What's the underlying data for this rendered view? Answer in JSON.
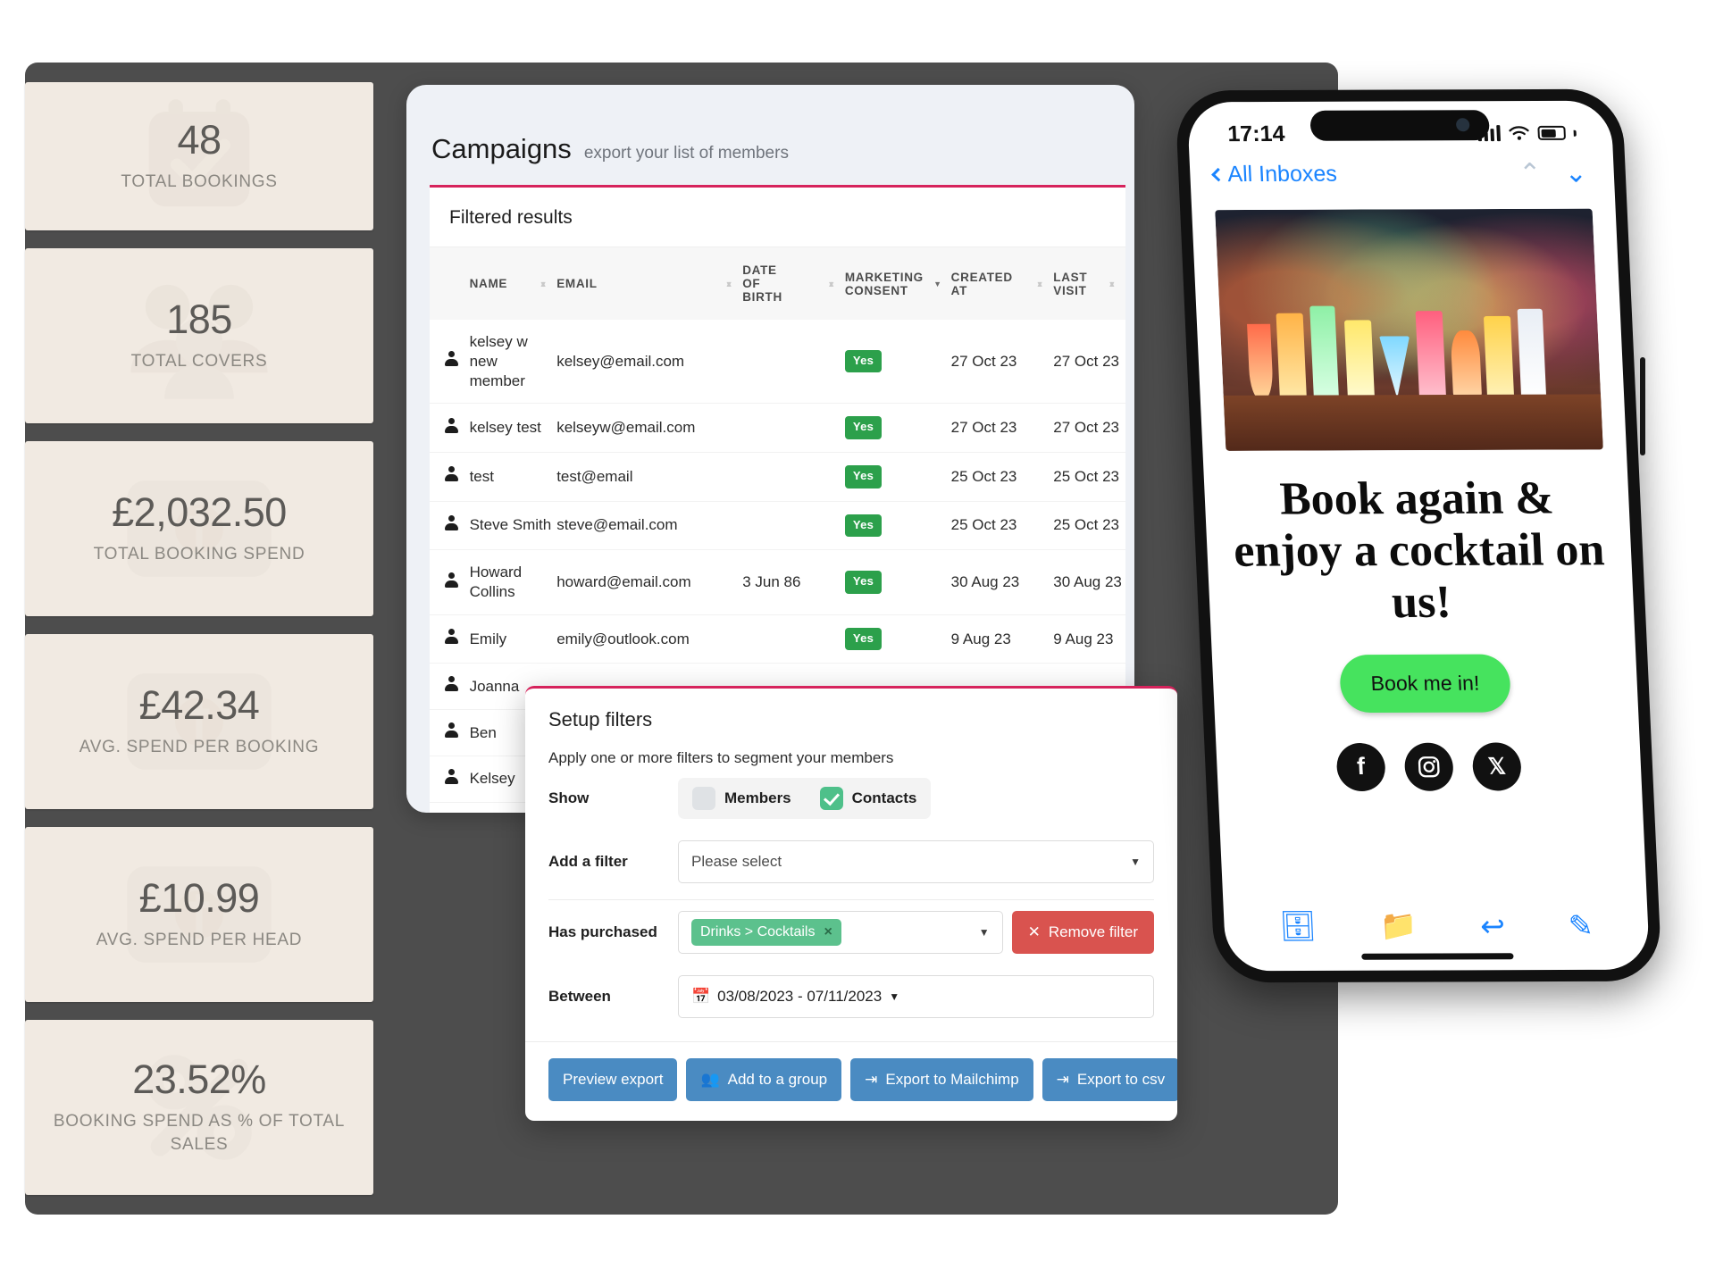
{
  "stats": [
    {
      "value": "48",
      "label": "TOTAL BOOKINGS",
      "icon": "calendar-check-icon"
    },
    {
      "value": "185",
      "label": "TOTAL COVERS",
      "icon": "people-icon"
    },
    {
      "value": "£2,032.50",
      "label": "TOTAL BOOKING SPEND",
      "icon": "banknote-icon"
    },
    {
      "value": "£42.34",
      "label": "AVG. SPEND PER BOOKING",
      "icon": "banknote-icon"
    },
    {
      "value": "£10.99",
      "label": "AVG. SPEND PER HEAD",
      "icon": "banknote-icon"
    },
    {
      "value": "23.52%",
      "label": "BOOKING SPEND AS % OF TOTAL SALES",
      "icon": "percent-icon"
    }
  ],
  "campaigns": {
    "title": "Campaigns",
    "subtitle": "export your list of members",
    "section_title": "Filtered results",
    "columns": [
      "NAME",
      "EMAIL",
      "DATE OF BIRTH",
      "MARKETING CONSENT",
      "CREATED AT",
      "LAST VISIT"
    ],
    "rows": [
      {
        "name": "kelsey w new member",
        "email": "kelsey@email.com",
        "dob": "",
        "consent": "Yes",
        "created": "27 Oct 23",
        "last_visit": "27 Oct 23"
      },
      {
        "name": "kelsey test",
        "email": "kelseyw@email.com",
        "dob": "",
        "consent": "Yes",
        "created": "27 Oct 23",
        "last_visit": "27 Oct 23"
      },
      {
        "name": "test",
        "email": "test@email",
        "dob": "",
        "consent": "Yes",
        "created": "25 Oct 23",
        "last_visit": "25 Oct 23"
      },
      {
        "name": "Steve Smith",
        "email": "steve@email.com",
        "dob": "",
        "consent": "Yes",
        "created": "25 Oct 23",
        "last_visit": "25 Oct 23"
      },
      {
        "name": "Howard Collins",
        "email": "howard@email.com",
        "dob": "3 Jun 86",
        "consent": "Yes",
        "created": "30 Aug 23",
        "last_visit": "30 Aug 23"
      },
      {
        "name": "Emily",
        "email": "emily@outlook.com",
        "dob": "",
        "consent": "Yes",
        "created": "9 Aug 23",
        "last_visit": "9 Aug 23"
      },
      {
        "name": "Joanna",
        "email": "",
        "dob": "",
        "consent": "",
        "created": "",
        "last_visit": ""
      },
      {
        "name": "Ben",
        "email": "",
        "dob": "",
        "consent": "",
        "created": "",
        "last_visit": ""
      },
      {
        "name": "Kelsey",
        "email": "",
        "dob": "",
        "consent": "",
        "created": "",
        "last_visit": ""
      }
    ]
  },
  "filters": {
    "title": "Setup filters",
    "description": "Apply one or more filters to segment your members",
    "show_label": "Show",
    "members_label": "Members",
    "members_checked": false,
    "contacts_label": "Contacts",
    "contacts_checked": true,
    "add_filter_label": "Add a filter",
    "add_filter_placeholder": "Please select",
    "has_purchased_label": "Has purchased",
    "has_purchased_chip": "Drinks > Cocktails",
    "remove_filter_label": "Remove filter",
    "between_label": "Between",
    "date_range": "03/08/2023 - 07/11/2023",
    "buttons": {
      "preview": "Preview export",
      "add_group": "Add to a group",
      "mailchimp": "Export to Mailchimp",
      "csv": "Export to csv"
    }
  },
  "phone": {
    "time": "17:14",
    "back_label": "All Inboxes",
    "headline": "Book again & enjoy a cocktail on us!",
    "cta_label": "Book me in!",
    "socials": [
      "facebook-icon",
      "instagram-icon",
      "x-twitter-icon"
    ]
  },
  "colors": {
    "accent": "#d6235c",
    "card_bg": "#f1eae2",
    "backdrop": "#4d4d4d",
    "green": "#2ca04b",
    "blue": "#4a8bc2",
    "red": "#d9534f",
    "ios_blue": "#1a84ff",
    "cta_green": "#46e35e"
  }
}
